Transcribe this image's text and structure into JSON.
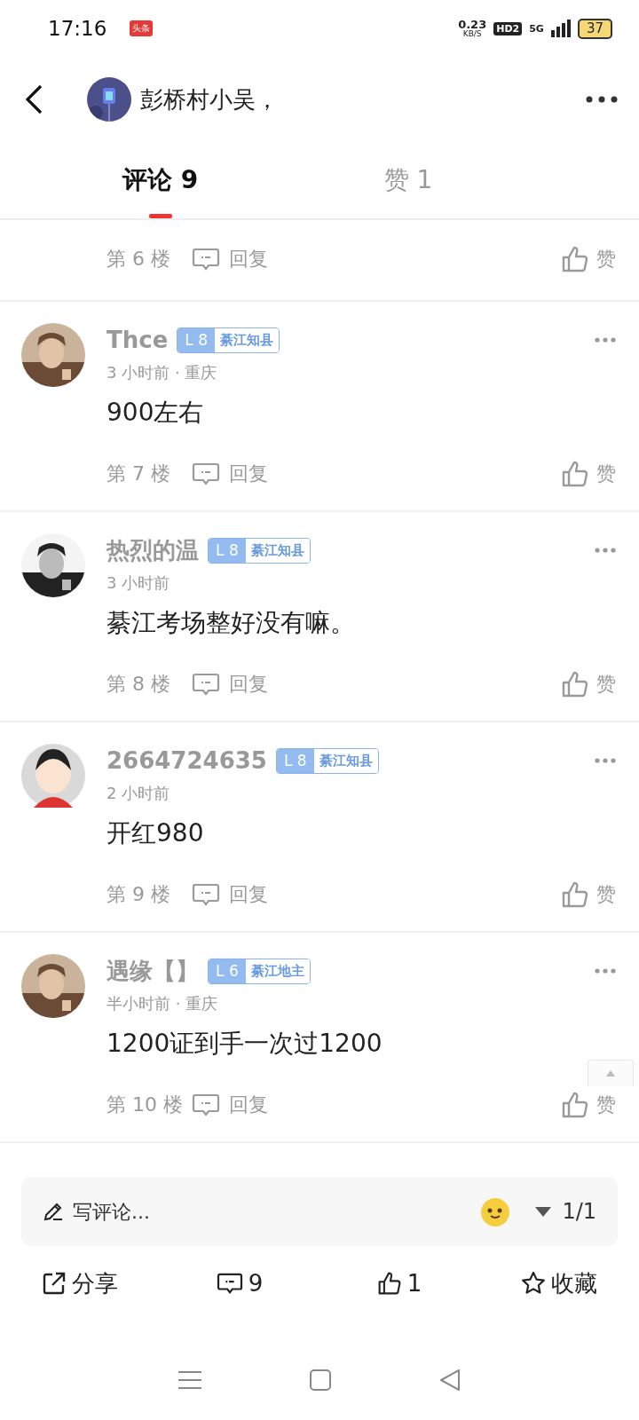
{
  "status_bar": {
    "time": "17:16",
    "app_badge": "头条",
    "speed": "0.23",
    "speed_unit": "KB/S",
    "hd": "HD2",
    "network": "5G",
    "battery": "37"
  },
  "header": {
    "title": "彭桥村小吴，"
  },
  "tabs": [
    {
      "label": "评论 9",
      "selected": true
    },
    {
      "label": "赞 1",
      "selected": false
    }
  ],
  "partial_comment": {
    "floor": "第 6 楼",
    "reply": "回复",
    "like": "赞"
  },
  "comments": [
    {
      "name": "Thce",
      "level": "L 8",
      "title": "綦江知县",
      "meta": "3 小时前 · 重庆",
      "text": "900左右",
      "floor": "第 7 楼",
      "reply": "回复",
      "like": "赞",
      "kind": "picture"
    },
    {
      "name": "热烈的温",
      "level": "L 8",
      "title": "綦江知县",
      "meta": "3 小时前",
      "text": "綦江考场整好没有嘛。",
      "floor": "第 8 楼",
      "reply": "回复",
      "like": "赞",
      "kind": "picture"
    },
    {
      "name": "2664724635",
      "level": "L 8",
      "title": "綦江知县",
      "meta": "2 小时前",
      "text": "开红980",
      "floor": "第 9 楼",
      "reply": "回复",
      "like": "赞",
      "kind": "avatar"
    },
    {
      "name": "遇缘【】",
      "level": "L 6",
      "title": "綦江地主",
      "meta": "半小时前 · 重庆",
      "text": "1200证到手一次过1200",
      "floor": "第 10 楼",
      "reply": "回复",
      "like": "赞",
      "kind": "picture"
    }
  ],
  "comment_box": {
    "placeholder": "写评论...",
    "page": "1/1"
  },
  "actions": [
    {
      "kind": "share",
      "label": "分享"
    },
    {
      "kind": "comment",
      "label": "9"
    },
    {
      "kind": "like",
      "label": "1"
    },
    {
      "kind": "star",
      "label": "收藏"
    }
  ]
}
